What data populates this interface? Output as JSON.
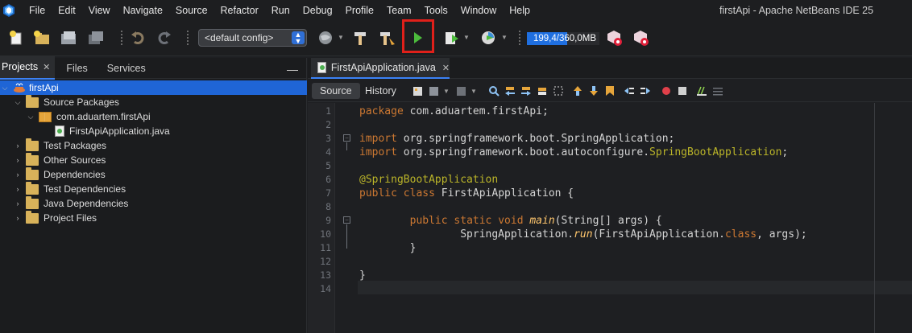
{
  "menubar": {
    "items": [
      "File",
      "Edit",
      "View",
      "Navigate",
      "Source",
      "Refactor",
      "Run",
      "Debug",
      "Profile",
      "Team",
      "Tools",
      "Window",
      "Help"
    ],
    "window_title": "firstApi - Apache NetBeans IDE 25"
  },
  "toolbar": {
    "config_value": "<default config>",
    "memory_text": "199,4/360,0MB",
    "memory_usage_fraction": 0.554,
    "run_button_highlighted": true,
    "highlight_color": "#e0201a"
  },
  "left_panel": {
    "tabs": [
      "Projects",
      "Files",
      "Services"
    ],
    "active_tab": "Projects",
    "tree": [
      {
        "label": "firstApi",
        "level": 0,
        "expanded": true,
        "icon": "project-cup-icon",
        "selected": true
      },
      {
        "label": "Source Packages",
        "level": 1,
        "expanded": true,
        "icon": "source-folder-icon"
      },
      {
        "label": "com.aduartem.firstApi",
        "level": 2,
        "expanded": true,
        "icon": "package-icon"
      },
      {
        "label": "FirstApiApplication.java",
        "level": 3,
        "expanded": null,
        "icon": "java-file-icon"
      },
      {
        "label": "Test Packages",
        "level": 1,
        "expanded": false,
        "icon": "folder-icon"
      },
      {
        "label": "Other Sources",
        "level": 1,
        "expanded": false,
        "icon": "folder-icon"
      },
      {
        "label": "Dependencies",
        "level": 1,
        "expanded": false,
        "icon": "folder-icon"
      },
      {
        "label": "Test Dependencies",
        "level": 1,
        "expanded": false,
        "icon": "folder-icon"
      },
      {
        "label": "Java Dependencies",
        "level": 1,
        "expanded": false,
        "icon": "folder-icon"
      },
      {
        "label": "Project Files",
        "level": 1,
        "expanded": false,
        "icon": "folder-icon"
      }
    ]
  },
  "editor": {
    "tab_label": "FirstApiApplication.java",
    "source_label": "Source",
    "history_label": "History",
    "line_numbers": [
      "1",
      "2",
      "3",
      "4",
      "5",
      "6",
      "7",
      "8",
      "9",
      "10",
      "11",
      "12",
      "13",
      "14"
    ],
    "lines": [
      {
        "n": 1,
        "text": "package com.aduartem.firstApi;"
      },
      {
        "n": 2,
        "text": ""
      },
      {
        "n": 3,
        "text": "import org.springframework.boot.SpringApplication;"
      },
      {
        "n": 4,
        "text": "import org.springframework.boot.autoconfigure.SpringBootApplication;"
      },
      {
        "n": 5,
        "text": ""
      },
      {
        "n": 6,
        "text": "@SpringBootApplication"
      },
      {
        "n": 7,
        "text": "public class FirstApiApplication {"
      },
      {
        "n": 8,
        "text": ""
      },
      {
        "n": 9,
        "text": "        public static void main(String[] args) {"
      },
      {
        "n": 10,
        "text": "                SpringApplication.run(FirstApiApplication.class, args);"
      },
      {
        "n": 11,
        "text": "        }"
      },
      {
        "n": 12,
        "text": ""
      },
      {
        "n": 13,
        "text": "}"
      },
      {
        "n": 14,
        "text": ""
      }
    ]
  },
  "colors": {
    "selection": "#1f65d6",
    "keyword": "#cc7832",
    "annotation": "#bbb529",
    "method": "#ffc66d",
    "background": "#1e1f22"
  }
}
